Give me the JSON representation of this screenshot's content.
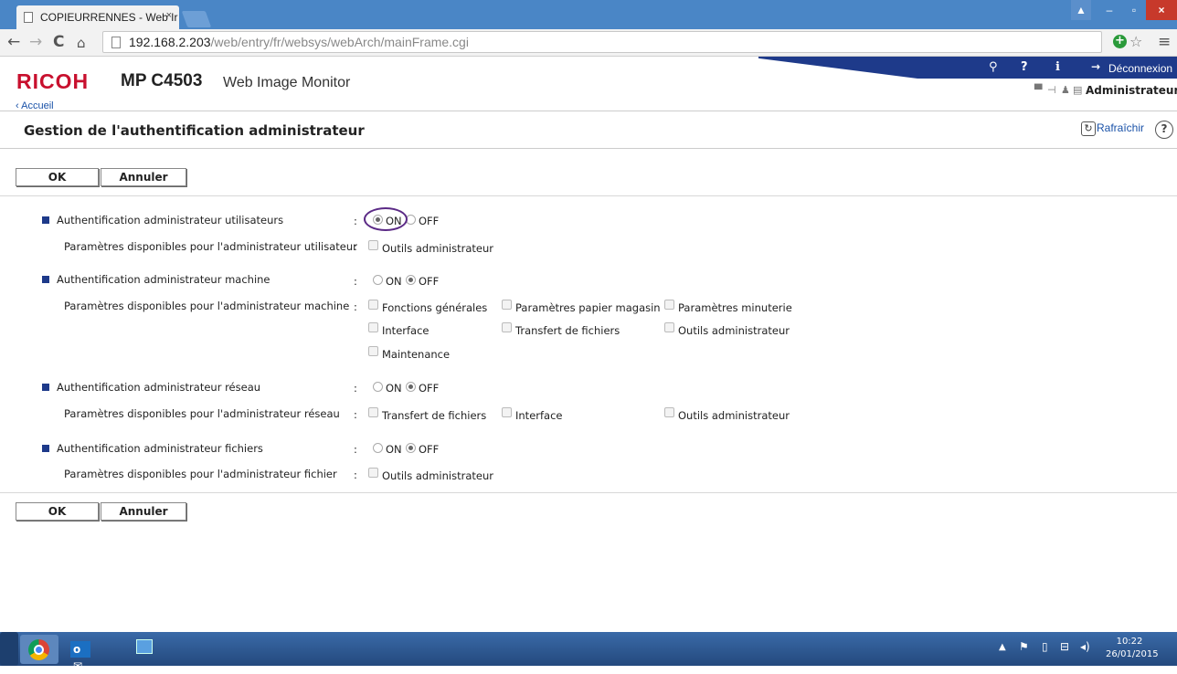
{
  "browser": {
    "tab_title": "COPIEURRENNES - Web Ir",
    "tab_close": "×",
    "url_host": "192.168.2.203",
    "url_path": "/web/entry/fr/websys/webArch/mainFrame.cgi",
    "win_min": "–",
    "win_max": "▫",
    "win_close": "×"
  },
  "header": {
    "brand": "RICOH",
    "model": "MP C4503",
    "product": "Web Image Monitor",
    "logout": "Déconnexion",
    "user": "Administrateur",
    "breadcrumb": "Accueil",
    "page_title": "Gestion de l'authentification administrateur",
    "refresh": "Rafraîchir",
    "help": "?"
  },
  "buttons": {
    "ok": "OK",
    "cancel": "Annuler"
  },
  "radio": {
    "on": "ON",
    "off": "OFF"
  },
  "colon": ":",
  "sections": {
    "users": {
      "label": "Authentification administrateur utilisateurs",
      "state": "ON",
      "params_label": "Paramètres disponibles pour l'administrateur utilisateur",
      "options": [
        "Outils administrateur"
      ]
    },
    "machine": {
      "label": "Authentification administrateur machine",
      "state": "OFF",
      "params_label": "Paramètres disponibles pour l'administrateur machine",
      "options": [
        "Fonctions générales",
        "Paramètres papier magasin",
        "Paramètres minuterie",
        "Interface",
        "Transfert de fichiers",
        "Outils administrateur",
        "Maintenance"
      ]
    },
    "network": {
      "label": "Authentification administrateur réseau",
      "state": "OFF",
      "params_label": "Paramètres disponibles pour l'administrateur réseau",
      "options": [
        "Transfert de fichiers",
        "Interface",
        "Outils administrateur"
      ]
    },
    "files": {
      "label": "Authentification administrateur fichiers",
      "state": "OFF",
      "params_label": "Paramètres disponibles pour l'administrateur fichier",
      "options": [
        "Outils administrateur"
      ]
    }
  },
  "taskbar": {
    "time": "10:22",
    "date": "26/01/2015",
    "outlook": "o"
  },
  "colors": {
    "accent": "#1e3a8a",
    "brand": "#c8102e",
    "annotation": "#5b2a86"
  }
}
